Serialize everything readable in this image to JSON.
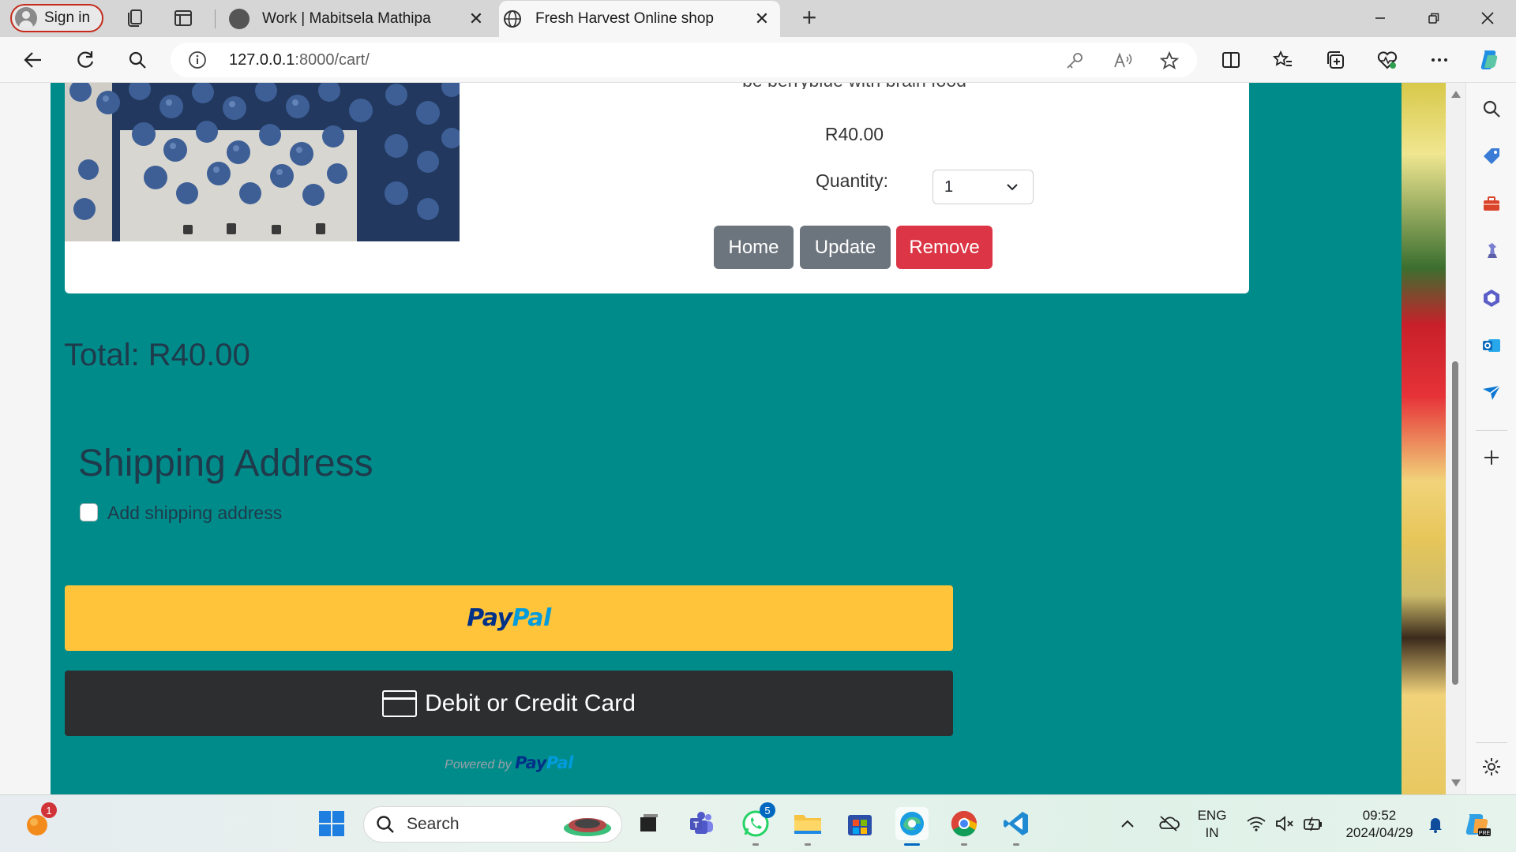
{
  "browser": {
    "signin_label": "Sign in",
    "tabs": [
      {
        "title": "Work | Mabitsela Mathipa",
        "active": false
      },
      {
        "title": "Fresh Harvest Online shop",
        "active": true
      }
    ],
    "url": {
      "host": "127.0.0.1",
      "path": ":8000/cart/"
    }
  },
  "cart": {
    "item": {
      "description_partial": "be berryblue with brain food",
      "price": "R40.00",
      "quantity_label": "Quantity:",
      "quantity_value": "1"
    },
    "buttons": {
      "home": "Home",
      "update": "Update",
      "remove": "Remove"
    },
    "total": "Total: R40.00"
  },
  "shipping": {
    "heading": "Shipping Address",
    "checkbox_label": "Add shipping address"
  },
  "payment": {
    "paypal_a": "Pay",
    "paypal_b": "Pal",
    "card_label": "Debit or Credit Card",
    "powered_by": "Powered by"
  },
  "taskbar": {
    "search_placeholder": "Search",
    "whatsapp_badge": "5",
    "notif_badge": "1",
    "lang_line1": "ENG",
    "lang_line2": "IN",
    "time": "09:52",
    "date": "2024/04/29"
  },
  "colors": {
    "page_bg": "#008b8b",
    "danger": "#dc3545",
    "secondary": "#6c757d",
    "paypal_yellow": "#ffc439"
  }
}
